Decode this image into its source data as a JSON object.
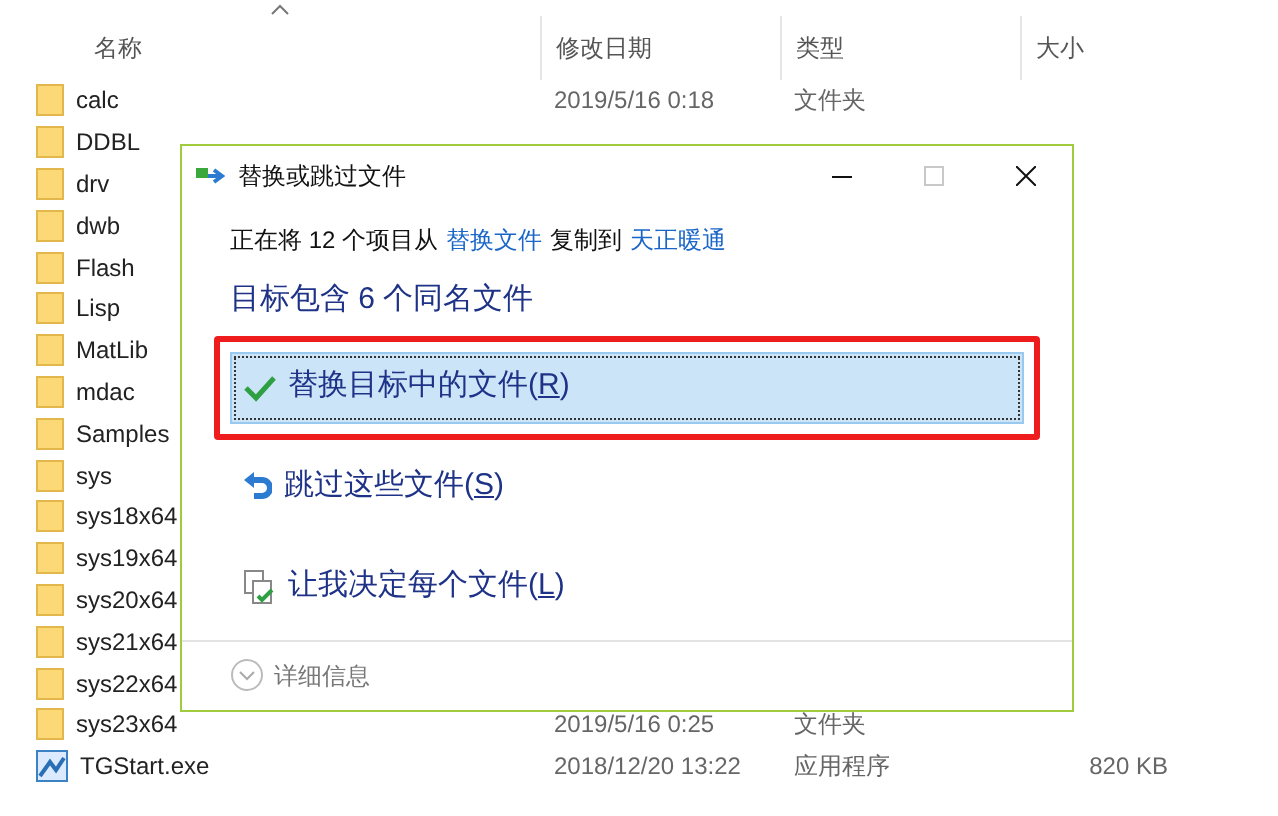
{
  "explorer": {
    "columns": [
      {
        "label": "名称"
      },
      {
        "label": "修改日期"
      },
      {
        "label": "类型"
      },
      {
        "label": "大小"
      }
    ],
    "rows": [
      {
        "kind": "folder",
        "name": "calc",
        "date": "2019/5/16 0:18",
        "type": "文件夹"
      },
      {
        "kind": "folder",
        "name": "DDBL"
      },
      {
        "kind": "folder",
        "name": "drv"
      },
      {
        "kind": "folder",
        "name": "dwb"
      },
      {
        "kind": "folder",
        "name": "Flash"
      },
      {
        "kind": "folder",
        "name": "Lisp"
      },
      {
        "kind": "folder",
        "name": "MatLib"
      },
      {
        "kind": "folder",
        "name": "mdac"
      },
      {
        "kind": "folder",
        "name": "Samples"
      },
      {
        "kind": "folder",
        "name": "sys"
      },
      {
        "kind": "folder",
        "name": "sys18x64"
      },
      {
        "kind": "folder",
        "name": "sys19x64"
      },
      {
        "kind": "folder",
        "name": "sys20x64"
      },
      {
        "kind": "folder",
        "name": "sys21x64"
      },
      {
        "kind": "folder",
        "name": "sys22x64"
      },
      {
        "kind": "folder",
        "name": "sys23x64",
        "date": "2019/5/16 0:25",
        "type": "文件夹"
      },
      {
        "kind": "exe",
        "name": "TGStart.exe",
        "date": "2018/12/20 13:22",
        "type": "应用程序",
        "size": "820 KB"
      }
    ]
  },
  "dialog": {
    "title": "替换或跳过文件",
    "maximize_disabled": true,
    "message": [
      {
        "kind": "text",
        "text": "正在将 12 个项目从"
      },
      {
        "kind": "link",
        "text": "替换文件"
      },
      {
        "kind": "text",
        "text": "复制到"
      },
      {
        "kind": "link",
        "text": "天正暖通"
      }
    ],
    "heading": "目标包含 6 个同名文件",
    "options": [
      {
        "kind": "replace",
        "before": "替换目标中的文件(",
        "key": "R",
        "after": ")",
        "selected": true,
        "highlighted": true
      },
      {
        "kind": "skip",
        "before": "跳过这些文件(",
        "key": "S",
        "after": ")",
        "selected": false,
        "highlighted": false
      },
      {
        "kind": "decide",
        "before": "让我决定每个文件(",
        "key": "L",
        "after": ")",
        "selected": false,
        "highlighted": false
      }
    ],
    "details": {
      "label": "详细信息",
      "expanded": false
    }
  }
}
